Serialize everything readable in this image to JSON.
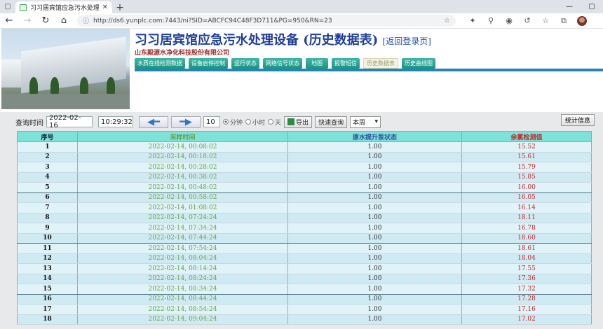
{
  "browser": {
    "tab_title": "习习居宾馆应急污水处理设备",
    "url": "http://ds6.yunplc.com:7443/ni?SID=ABCFC94C48F3D711&PG=950&RN=23"
  },
  "header": {
    "title": "习习居宾馆应急污水处理设备 (历史数据表)",
    "back_link": "[返回登录页]",
    "company": "山东殿源水净化科技股份有限公司",
    "menu": [
      {
        "label": "水质在线检测数据",
        "active": false
      },
      {
        "label": "设备启停控制",
        "active": false
      },
      {
        "label": "运行状态",
        "active": false
      },
      {
        "label": "网络信号状态",
        "active": false
      },
      {
        "label": "地图",
        "active": false
      },
      {
        "label": "报警短信",
        "active": false
      },
      {
        "label": "历史数据表",
        "active": true
      },
      {
        "label": "历史曲线图",
        "active": false
      }
    ]
  },
  "query": {
    "label": "查询时间",
    "date": "2022-02-16",
    "time": "10:29:32",
    "count": "10",
    "unit_minute": "分钟",
    "unit_hour": "小时",
    "unit_day": "天",
    "export_label": "导出",
    "quick_query_label": "快速查询",
    "period_select": "本周",
    "stats_label": "统计信息"
  },
  "table": {
    "columns": [
      "序号",
      "采样时间",
      "原水提升泵状态",
      "余氯检测值"
    ],
    "rows": [
      [
        "1",
        "2022-02-14, 00:08:02",
        "1.00",
        "15.52"
      ],
      [
        "2",
        "2022-02-14, 00:18:02",
        "1.00",
        "15.61"
      ],
      [
        "3",
        "2022-02-14, 00:28:02",
        "1.00",
        "15.79"
      ],
      [
        "4",
        "2022-02-14, 00:38:02",
        "1.00",
        "15.85"
      ],
      [
        "5",
        "2022-02-14, 00:48:02",
        "1.00",
        "16.00"
      ],
      [
        "6",
        "2022-02-14, 00:58:02",
        "1.00",
        "16.05"
      ],
      [
        "7",
        "2022-02-14, 01:08:02",
        "1.00",
        "16.14"
      ],
      [
        "8",
        "2022-02-14, 07:24:24",
        "1.00",
        "18.11"
      ],
      [
        "9",
        "2022-02-14, 07:34:24",
        "1.00",
        "16.78"
      ],
      [
        "10",
        "2022-02-14, 07:44:24",
        "1.00",
        "18.60"
      ],
      [
        "11",
        "2022-02-14, 07:54:24",
        "1.00",
        "18.61"
      ],
      [
        "12",
        "2022-02-14, 08:04:24",
        "1.00",
        "18.04"
      ],
      [
        "13",
        "2022-02-14, 08:14:24",
        "1.00",
        "17.55"
      ],
      [
        "14",
        "2022-02-14, 08:24:24",
        "1.00",
        "17.36"
      ],
      [
        "15",
        "2022-02-14, 08:34:24",
        "1.00",
        "17.32"
      ],
      [
        "16",
        "2022-02-14, 08:44:24",
        "1.00",
        "17.28"
      ],
      [
        "17",
        "2022-02-14, 08:54:24",
        "1.00",
        "17.16"
      ],
      [
        "18",
        "2022-02-14, 09:04:24",
        "1.00",
        "17.02"
      ]
    ]
  },
  "colors": {
    "title": "#1f3f9a",
    "menu": "#18957f",
    "table_header": "#7de2d7",
    "chlorine": "#c0282a",
    "time": "#6aa24e"
  }
}
